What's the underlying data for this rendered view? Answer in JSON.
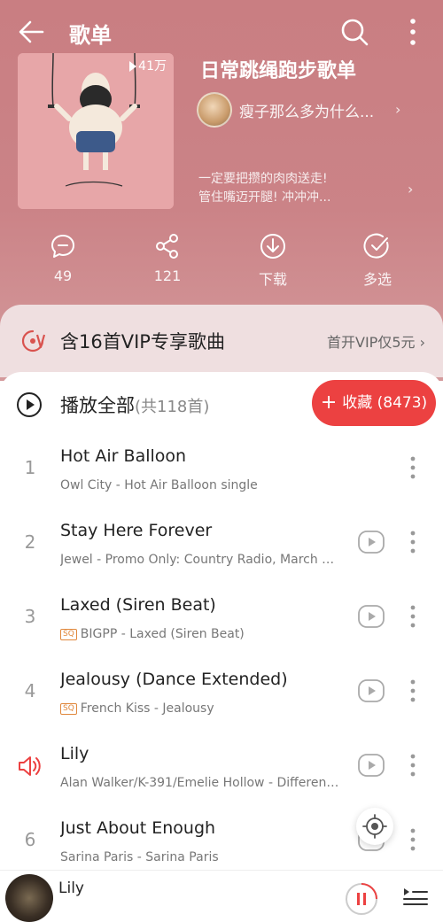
{
  "header": {
    "title": "歌单"
  },
  "playlist": {
    "play_count": "41万",
    "title": "日常跳绳跑步歌单",
    "creator": "瘦子那么多为什么...",
    "description_line1": "一定要把攒的肉肉送走!",
    "description_line2": "管住嘴迈开腿! 冲冲冲..."
  },
  "actions": [
    {
      "label": "49",
      "icon": "comment-icon"
    },
    {
      "label": "121",
      "icon": "share-icon"
    },
    {
      "label": "下载",
      "icon": "download-icon"
    },
    {
      "label": "多选",
      "icon": "multiselect-icon"
    }
  ],
  "vip": {
    "text": "含16首VIP专享歌曲",
    "cta": "首开VIP仅5元"
  },
  "play_all": {
    "label": "播放全部",
    "count": "(共118首)",
    "collect_label": "收藏 (8473)"
  },
  "songs": [
    {
      "index": "1",
      "title": "Hot Air Balloon",
      "sq": "",
      "meta": "Owl City - Hot Air Balloon single",
      "mv": false
    },
    {
      "index": "2",
      "title": "Stay Here Forever",
      "sq": "",
      "meta": "Jewel - Promo Only: Country Radio, March 20...",
      "mv": true
    },
    {
      "index": "3",
      "title": "Laxed (Siren Beat)",
      "sq": "SQ",
      "meta": "BIGPP - Laxed (Siren Beat)",
      "mv": true
    },
    {
      "index": "4",
      "title": "Jealousy (Dance Extended)",
      "sq": "SQ",
      "meta": "French Kiss - Jealousy",
      "mv": true
    },
    {
      "index": "",
      "title": "Lily",
      "sq": "",
      "meta": "Alan Walker/K-391/Emelie Hollow - Different...",
      "mv": true,
      "playing": true
    },
    {
      "index": "6",
      "title": "Just About Enough",
      "sq": "",
      "meta": "Sarina Paris - Sarina Paris",
      "mv": true
    }
  ],
  "player": {
    "now_playing": "Lily"
  },
  "colors": {
    "header_bg": "#c97e82",
    "accent_red": "#ec4141",
    "sq_orange": "#e0873b"
  }
}
